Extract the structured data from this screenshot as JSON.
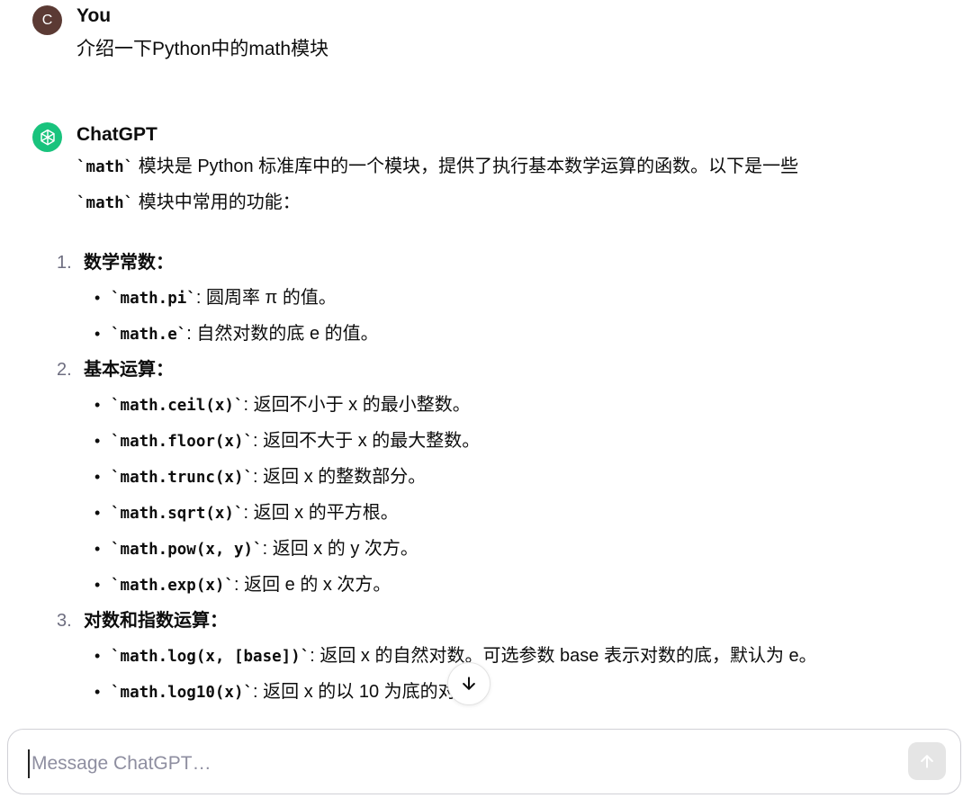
{
  "user_message": {
    "avatar_letter": "C",
    "author": "You",
    "text": "介绍一下Python中的math模块"
  },
  "assistant_message": {
    "author": "ChatGPT",
    "intro": {
      "p1_code": "`math`",
      "p1_text": " 模块是 Python 标准库中的一个模块，提供了执行基本数学运算的函数。以下是一些 ",
      "p2_code": "`math`",
      "p2_text": " 模块中常用的功能："
    },
    "sections": [
      {
        "number": "1.",
        "title": "数学常数：",
        "items": [
          {
            "code": "`math.pi`",
            "text": ": 圆周率 π 的值。"
          },
          {
            "code": "`math.e`",
            "text": ": 自然对数的底 e 的值。"
          }
        ]
      },
      {
        "number": "2.",
        "title": "基本运算：",
        "items": [
          {
            "code": "`math.ceil(x)`",
            "text": ": 返回不小于 x 的最小整数。"
          },
          {
            "code": "`math.floor(x)`",
            "text": ": 返回不大于 x 的最大整数。"
          },
          {
            "code": "`math.trunc(x)`",
            "text": ": 返回 x 的整数部分。"
          },
          {
            "code": "`math.sqrt(x)`",
            "text": ": 返回 x 的平方根。"
          },
          {
            "code": "`math.pow(x, y)`",
            "text": ": 返回 x 的 y 次方。"
          },
          {
            "code": "`math.exp(x)`",
            "text": ": 返回 e 的 x 次方。"
          }
        ]
      },
      {
        "number": "3.",
        "title": "对数和指数运算：",
        "items": [
          {
            "code": "`math.log(x, [base])`",
            "text": ": 返回 x 的自然对数。可选参数 base 表示对数的底，默认为 e。"
          },
          {
            "code": "`math.log10(x)`",
            "text": ": 返回 x 的以 10 为底的对数。"
          }
        ]
      }
    ]
  },
  "composer": {
    "placeholder": "Message ChatGPT…"
  },
  "colors": {
    "gpt_avatar": "#19c37d",
    "user_avatar": "#5b3a34"
  }
}
